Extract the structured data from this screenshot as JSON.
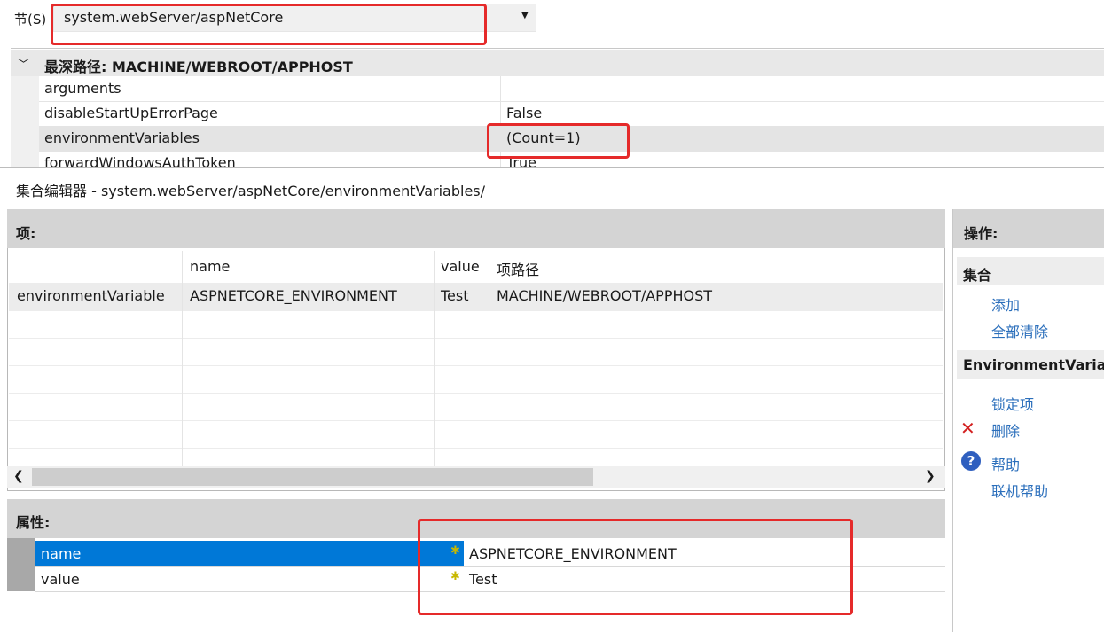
{
  "section": {
    "label": "节(S)",
    "value": "system.webServer/aspNetCore"
  },
  "property_grid": {
    "title": "最深路径: MACHINE/WEBROOT/APPHOST",
    "rows": [
      {
        "key": "arguments",
        "value": ""
      },
      {
        "key": "disableStartUpErrorPage",
        "value": "False"
      },
      {
        "key": "environmentVariables",
        "value": "(Count=1)"
      },
      {
        "key": "forwardWindowsAuthToken",
        "value": "True"
      }
    ]
  },
  "dialog": {
    "title": "集合编辑器 - system.webServer/aspNetCore/environmentVariables/"
  },
  "items": {
    "title": "项:",
    "columns": [
      "",
      "name",
      "value",
      "项路径"
    ],
    "rows": [
      [
        "environmentVariable",
        "ASPNETCORE_ENVIRONMENT",
        "Test",
        "MACHINE/WEBROOT/APPHOST"
      ]
    ]
  },
  "properties": {
    "title": "属性:",
    "rows": [
      {
        "key": "name",
        "value": "ASPNETCORE_ENVIRONMENT",
        "selected": true
      },
      {
        "key": "value",
        "value": "Test",
        "selected": false
      }
    ]
  },
  "actions": {
    "title": "操作:",
    "collection_group": "集合",
    "add": "添加",
    "clear_all": "全部清除",
    "item_group": "EnvironmentVariable",
    "lock": "锁定项",
    "delete": "删除",
    "help": "帮助",
    "online_help": "联机帮助"
  },
  "colors": {
    "accent": "#0078d7",
    "annotation": "#e52a2a",
    "link": "#2a6ebb"
  }
}
